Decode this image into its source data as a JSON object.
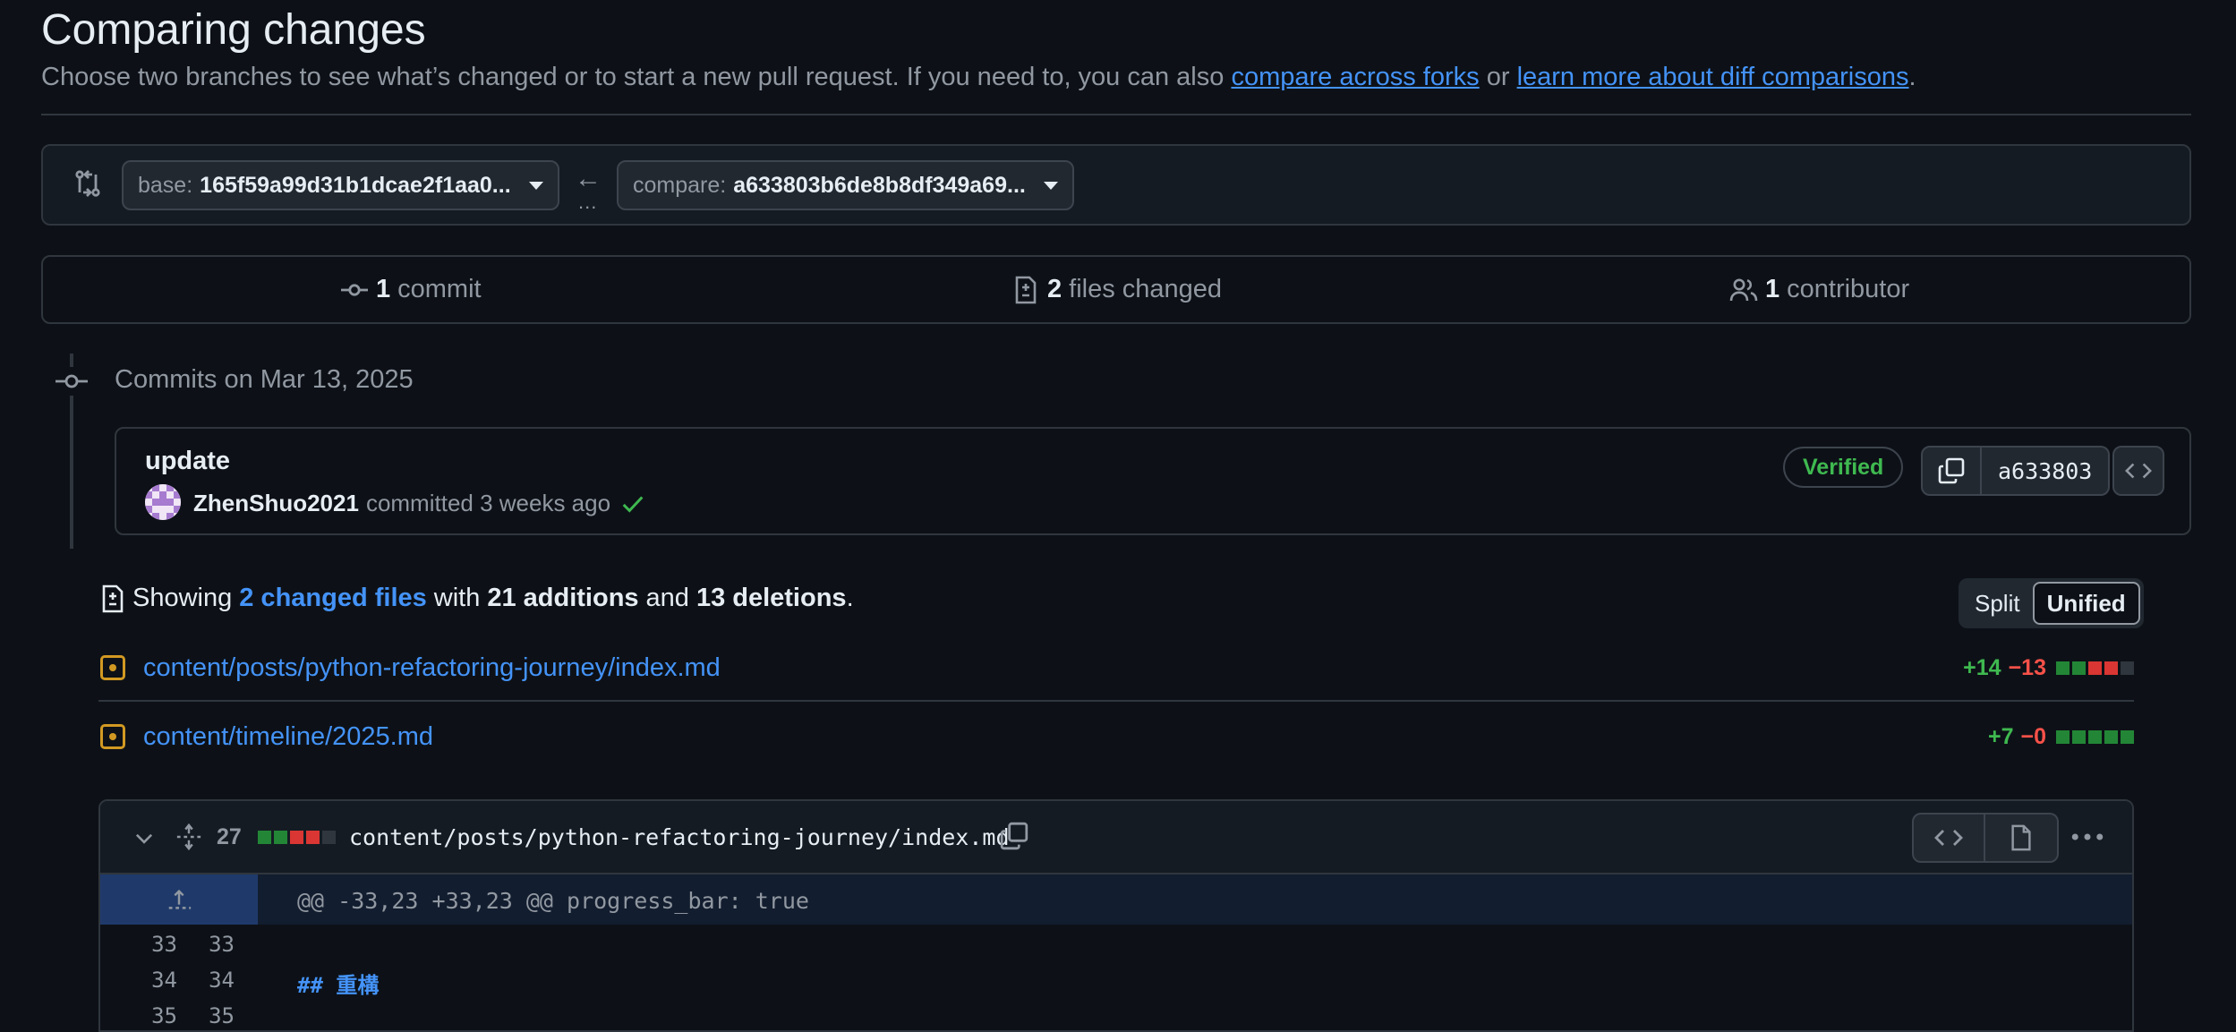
{
  "header": {
    "title": "Comparing changes",
    "subtitle_text": "Choose two branches to see what’s changed or to start a new pull request. If you need to, you can also",
    "link_forks": "compare across forks",
    "or_text": "or",
    "link_learn": "learn more about diff comparisons",
    "period": "."
  },
  "range": {
    "base_label": "base:",
    "base_value": "165f59a99d31b1dcae2f1aa0...",
    "compare_label": "compare:",
    "compare_value": "a633803b6de8b8df349a69...",
    "arrow": "←",
    "dots": "..."
  },
  "stats": {
    "commits_count": "1",
    "commits_label": "commit",
    "files_count": "2",
    "files_label": "files changed",
    "contributors_count": "1",
    "contributors_label": "contributor"
  },
  "timeline": {
    "date_heading": "Commits on Mar 13, 2025"
  },
  "commit": {
    "message": "update",
    "author": "ZhenShuo2021",
    "action": "committed 3 weeks ago",
    "verified": "Verified",
    "sha": "a633803"
  },
  "summary": {
    "showing": "Showing",
    "changed_files": "2 changed files",
    "with": "with",
    "additions": "21 additions",
    "and": "and",
    "deletions": "13 deletions",
    "period": "."
  },
  "view_toggle": {
    "split": "Split",
    "unified": "Unified",
    "selected": "Unified"
  },
  "files": [
    {
      "path": "content/posts/python-refactoring-journey/index.md",
      "additions": "+14",
      "deletions": "−13",
      "blocks": [
        "g",
        "g",
        "r",
        "r",
        "n"
      ]
    },
    {
      "path": "content/timeline/2025.md",
      "additions": "+7",
      "deletions": "−0",
      "blocks": [
        "g",
        "g",
        "g",
        "g",
        "g"
      ]
    }
  ],
  "diff": {
    "changes": "27",
    "blocks": [
      "g",
      "g",
      "r",
      "r",
      "n"
    ],
    "filename": "content/posts/python-refactoring-journey/index.md",
    "hunk_header": "@@ -33,23 +33,23 @@ progress_bar: true",
    "lines": [
      {
        "old": "33",
        "new": "33",
        "text": ""
      },
      {
        "old": "34",
        "new": "34",
        "text": "## 重構"
      },
      {
        "old": "35",
        "new": "35",
        "text": ""
      }
    ]
  },
  "colors": {
    "background": "#0d1117",
    "link": "#4493f8",
    "addition": "#3fb950",
    "deletion": "#f85149",
    "modified": "#d29922"
  }
}
